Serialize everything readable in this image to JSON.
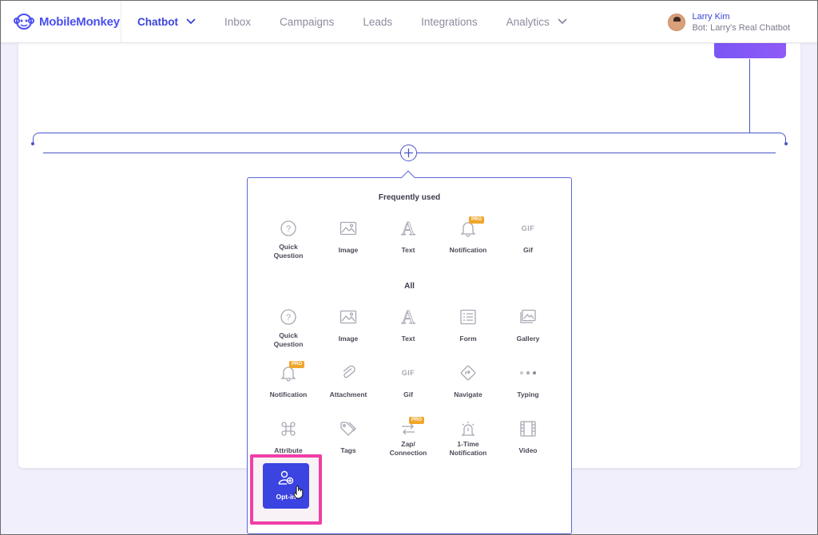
{
  "brand": {
    "name": "MobileMonkey",
    "accent": "#3b44d6"
  },
  "nav": {
    "chatbot": "Chatbot",
    "inbox": "Inbox",
    "campaigns": "Campaigns",
    "leads": "Leads",
    "integrations": "Integrations",
    "analytics": "Analytics"
  },
  "user": {
    "name": "Larry Kim",
    "bot": "Bot: Larry's Real Chatbot"
  },
  "popup": {
    "frequent_title": "Frequently used",
    "all_title": "All",
    "pro_badge": "PRO",
    "frequent": {
      "quick_question": "Quick Question",
      "image": "Image",
      "text": "Text",
      "notification": "Notification",
      "gif": "Gif"
    },
    "all": {
      "quick_question": "Quick Question",
      "image": "Image",
      "text": "Text",
      "form": "Form",
      "gallery": "Gallery",
      "notification": "Notification",
      "attachment": "Attachment",
      "gif": "Gif",
      "navigate": "Navigate",
      "typing": "Typing",
      "attribute": "Attribute",
      "tags": "Tags",
      "zap_connection": "Zap/ Connection",
      "one_time_notification": "1-Time Notification",
      "video": "Video",
      "opt_in": "Opt-in"
    },
    "gif_glyph": "GIF",
    "text_glyph": "A",
    "quick_question_glyph": "?"
  },
  "colors": {
    "highlight": "#f03ea8",
    "optin_bg": "#3b44e0",
    "pro": "#f0a62a"
  }
}
